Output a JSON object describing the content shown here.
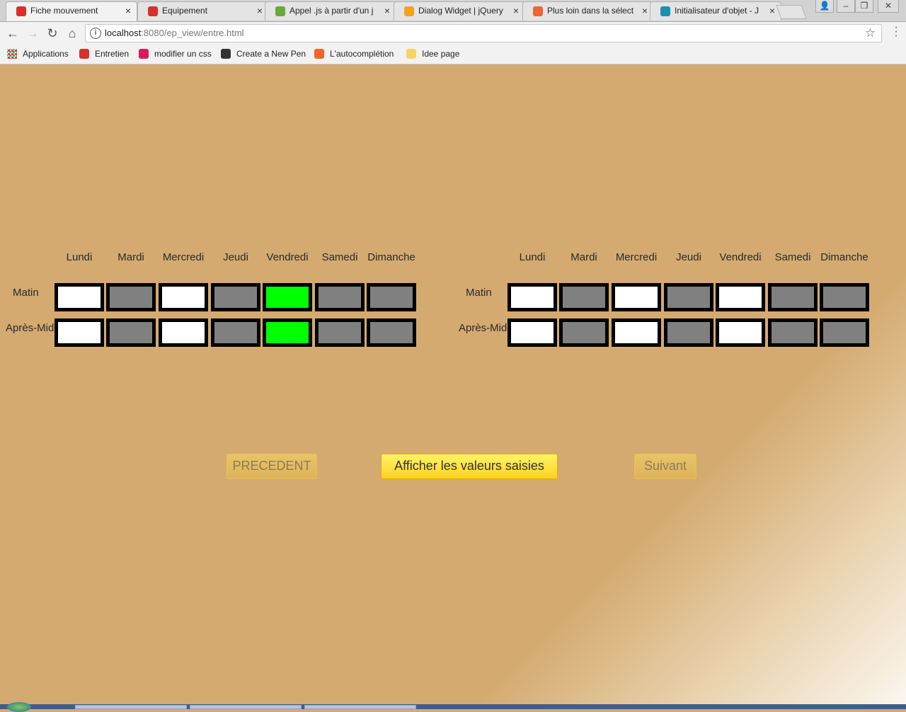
{
  "browser": {
    "tabs": [
      {
        "title": "Fiche mouvement",
        "active": true,
        "favicon_color": "#d9302a"
      },
      {
        "title": "Equipement",
        "active": false,
        "favicon_color": "#d9302a"
      },
      {
        "title": "Appel .js à partir d'un j",
        "active": false,
        "favicon_color": "#6aa83a"
      },
      {
        "title": "Dialog Widget | jQuery",
        "active": false,
        "favicon_color": "#f4a31b"
      },
      {
        "title": "Plus loin dans la sélect",
        "active": false,
        "favicon_color": "#f0652c"
      },
      {
        "title": "Initialisateur d'objet - J",
        "active": false,
        "favicon_color": "#1a8fb0"
      }
    ],
    "close_glyph": "×",
    "url": {
      "host": "localhost",
      "rest": ":8080/ep_view/entre.html"
    },
    "bookmarks": [
      {
        "label": "Applications",
        "icon": "apps-grid-icon"
      },
      {
        "label": "Entretien",
        "icon": "chat-bubble-icon",
        "color": "#d9302a"
      },
      {
        "label": "modifier un css",
        "icon": "vo-icon",
        "color": "#d81b60"
      },
      {
        "label": "Create a New Pen",
        "icon": "codepen-icon",
        "color": "#333333"
      },
      {
        "label": "L'autocomplétion",
        "icon": "openclassrooms-icon",
        "color": "#f0652c"
      },
      {
        "label": "Idee page",
        "icon": "folder-icon",
        "color": "#f6d365"
      }
    ]
  },
  "schedule": {
    "days": [
      "Lundi",
      "Mardi",
      "Mercredi",
      "Jeudi",
      "Vendredi",
      "Samedi",
      "Dimanche"
    ],
    "rows": [
      "Matin",
      "Après-Midi"
    ],
    "colors": {
      "white": "#ffffff",
      "gray": "#808080",
      "green": "#00ff00",
      "border": "#000000"
    },
    "grids": [
      {
        "cells": [
          [
            "white",
            "gray",
            "white",
            "gray",
            "green",
            "gray",
            "gray"
          ],
          [
            "white",
            "gray",
            "white",
            "gray",
            "green",
            "gray",
            "gray"
          ]
        ]
      },
      {
        "cells": [
          [
            "white",
            "gray",
            "white",
            "gray",
            "white",
            "gray",
            "gray"
          ],
          [
            "white",
            "gray",
            "white",
            "gray",
            "white",
            "gray",
            "gray"
          ]
        ]
      }
    ]
  },
  "buttons": {
    "prev": "PRECEDENT",
    "show": "Afficher les valeurs saisies",
    "next": "Suivant"
  },
  "page_background": "#d4aa70"
}
